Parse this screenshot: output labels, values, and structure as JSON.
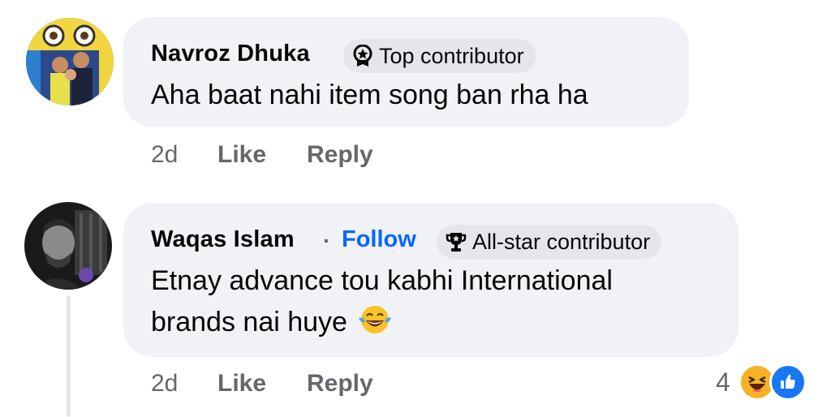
{
  "comments": [
    {
      "author": "Navroz Dhuka",
      "badge": "Top contributor",
      "badge_icon": "top-contributor-icon",
      "text": "Aha baat nahi item song ban rha ha",
      "time": "2d",
      "like_label": "Like",
      "reply_label": "Reply"
    },
    {
      "author": "Waqas Islam",
      "separator": "·",
      "follow_label": "Follow",
      "badge": "All-star contributor",
      "badge_icon": "trophy-icon",
      "text_line1": "Etnay advance tou kabhi International",
      "text_line2": "brands nai huye",
      "text_emoji": "face-with-tears-of-joy-icon",
      "time": "2d",
      "like_label": "Like",
      "reply_label": "Reply",
      "reaction_count": "4",
      "reaction_icons": [
        "haha-reaction-icon",
        "like-reaction-icon"
      ]
    }
  ],
  "colors": {
    "bubble": "#f0f2f5",
    "badge": "#e4e6eb",
    "follow": "#0866ff",
    "meta": "#65676b",
    "like_reaction": "#1877f2",
    "haha_reaction": "#f7b125"
  }
}
